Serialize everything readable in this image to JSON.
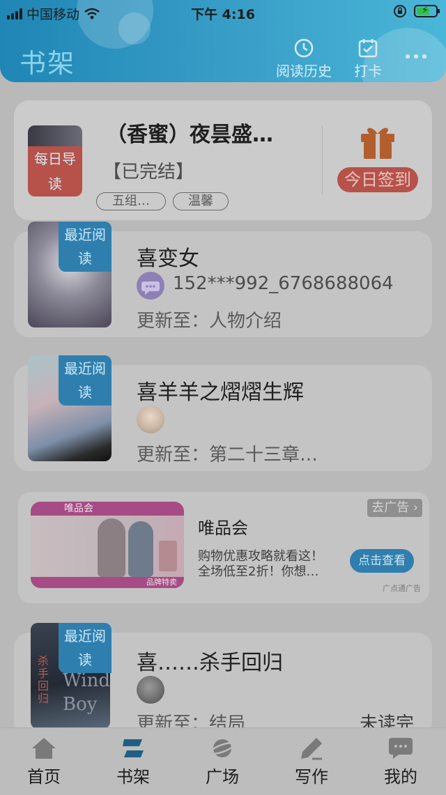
{
  "status_bar": {
    "carrier": "中国移动",
    "time": "下午 4:16"
  },
  "header": {
    "title": "书架",
    "history_label": "阅读历史",
    "checkin_label": "打卡"
  },
  "featured": {
    "title": "（香蜜）夜昙盛…",
    "badge": "每日导读",
    "status": "【已完结】",
    "tags": [
      "五组…",
      "温馨"
    ],
    "checkin_button": "今日签到"
  },
  "books": [
    {
      "title": "喜变女",
      "badge": "最近阅读",
      "author": "152***992_6768688064",
      "update": "更新至：人物介绍"
    },
    {
      "title": "喜羊羊之熠熠生辉",
      "badge": "最近阅读",
      "author": "",
      "update": "更新至：第二十三章…"
    },
    {
      "title": "喜……杀手回归",
      "badge": "最近阅读",
      "author": "",
      "update": "更新至：结局",
      "read_status": "未读完",
      "cover_text": "Wind Boy"
    }
  ],
  "ad": {
    "close_label": "去广告",
    "brand": "唯品会",
    "desc_line1": "购物优惠攻略就看这！",
    "desc_line2": "全场低至2折！你想…",
    "button": "点击查看",
    "source": "广点通广告",
    "banner_brand": "唯品会",
    "banner_corner": "品牌特卖"
  },
  "nav": {
    "items": [
      {
        "label": "首页",
        "icon": "home-icon"
      },
      {
        "label": "书架",
        "icon": "bookshelf-icon"
      },
      {
        "label": "广场",
        "icon": "planet-icon"
      },
      {
        "label": "写作",
        "icon": "pen-icon"
      },
      {
        "label": "我的",
        "icon": "chat-bubble-icon"
      }
    ],
    "active": "书架"
  },
  "colors": {
    "header_blue": "#2a8fbf",
    "checkin_red": "#b6524a",
    "badge_blue": "#2f7fae",
    "overlay_gray": "#b9b9b9"
  }
}
